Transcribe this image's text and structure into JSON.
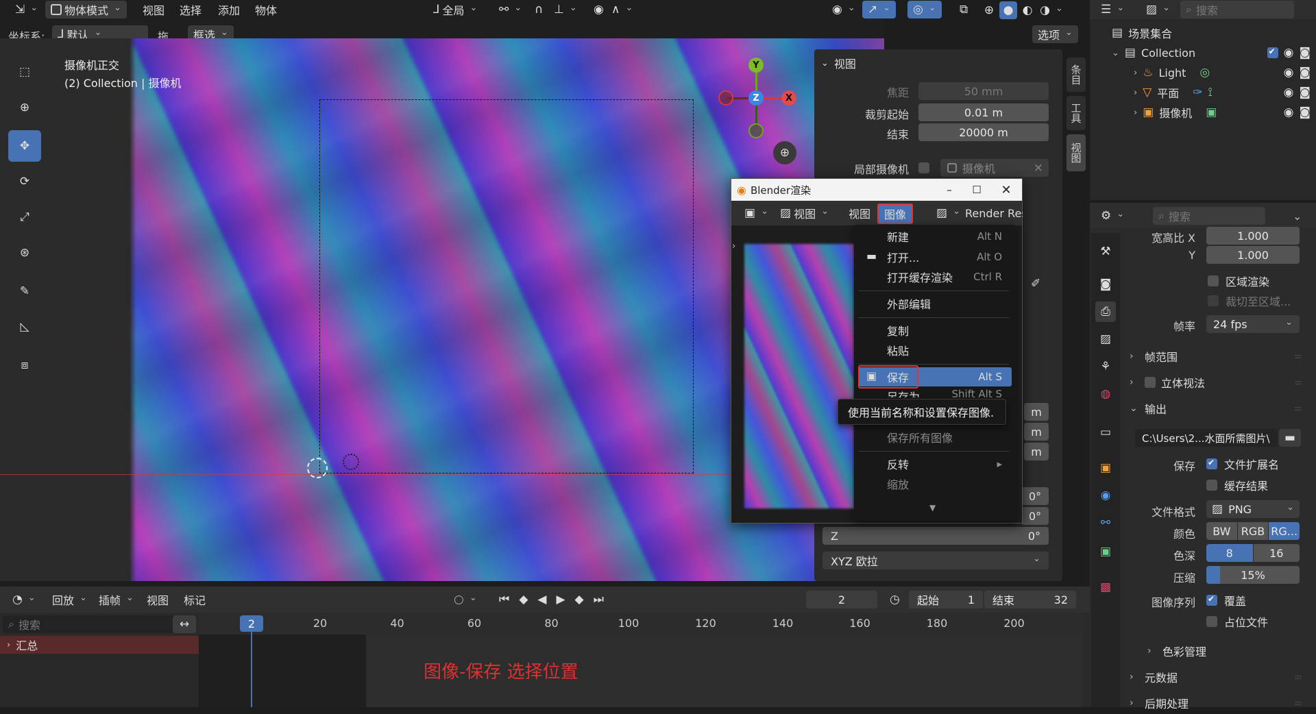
{
  "topbar": {
    "editor_icon": "axis-editor-icon",
    "mode": "物体模式",
    "menus": [
      "视图",
      "选择",
      "添加",
      "物体"
    ],
    "orientation": "全局",
    "options": "选项"
  },
  "toolheader": {
    "coord_label": "坐标系:",
    "coord_value": "默认",
    "drag_label": "拖...",
    "select_mode": "框选"
  },
  "viewport": {
    "overlay_line1": "摄像机正交",
    "overlay_line2": "(2) Collection | 摄像机",
    "gizmo": {
      "x": "X",
      "y": "Y",
      "z": "Z"
    }
  },
  "npanel": {
    "section": "视图",
    "focal_label": "焦距",
    "focal_value": "50 mm",
    "clip_start_label": "裁剪起始",
    "clip_start_value": "0.01 m",
    "clip_end_label": "结束",
    "clip_end_value": "20000 m",
    "local_camera_label": "局部摄像机",
    "local_camera_value": "摄像机",
    "tabs": [
      "条目",
      "工具",
      "视图"
    ],
    "partial_units": [
      "m",
      "m",
      "m"
    ],
    "rot_values": [
      "0°",
      "0°"
    ],
    "z_label": "Z",
    "z_value": "0°",
    "rot_mode": "XYZ 欧拉"
  },
  "render_window": {
    "title": "Blender渲染",
    "menu_view_dd": "视图",
    "menu_view": "视图",
    "menu_image": "图像",
    "render_result": "Render Res"
  },
  "image_menu": {
    "new": "新建",
    "new_sc": "Alt N",
    "open": "打开...",
    "open_sc": "Alt O",
    "open_cache": "打开缓存渲染",
    "open_cache_sc": "Ctrl R",
    "external_edit": "外部编辑",
    "copy": "复制",
    "paste": "粘贴",
    "save": "保存",
    "save_sc": "Alt S",
    "save_as_partial": "另存为",
    "save_as_sc_partial": "Shift Alt S",
    "save_all": "保存所有图像",
    "invert": "反转",
    "zoom": "缩放",
    "tooltip": "使用当前名称和设置保存图像."
  },
  "outliner": {
    "search_placeholder": "搜索",
    "scene_collection": "场景集合",
    "collection": "Collection",
    "items": [
      "Light",
      "平面",
      "摄像机"
    ]
  },
  "properties": {
    "search_placeholder": "搜索",
    "aspect_x_label": "宽高比 X",
    "aspect_x": "1.000",
    "aspect_y_label": "Y",
    "aspect_y": "1.000",
    "region_render": "区域渲染",
    "crop_region": "裁切至区域...",
    "fps_label": "帧率",
    "fps": "24 fps",
    "frame_range": "帧范围",
    "stereo": "立体视法",
    "output": "输出",
    "output_path": "C:\\Users\\2...水面所需图片\\",
    "save_label": "保存",
    "file_ext": "文件扩展名",
    "cache_result": "缓存结果",
    "format_label": "文件格式",
    "format": "PNG",
    "color_label": "颜色",
    "color_opts": [
      "BW",
      "RGB",
      "RG..."
    ],
    "depth_label": "色深",
    "depth_opts": [
      "8",
      "16"
    ],
    "compress_label": "压缩",
    "compress": "15%",
    "compress_fraction": 0.15,
    "seq_label": "图像序列",
    "overwrite": "覆盖",
    "placeholder": "占位文件",
    "color_mgmt": "色彩管理",
    "metadata": "元数据",
    "post": "后期处理"
  },
  "timeline": {
    "playback": "回放",
    "keying": "插帧",
    "view": "视图",
    "marker": "标记",
    "current": "2",
    "start_label": "起始",
    "start": "1",
    "end_label": "结束",
    "end": "32",
    "search_placeholder": "搜索",
    "summary": "汇总",
    "ticks": [
      "20",
      "40",
      "60",
      "80",
      "100",
      "120",
      "140",
      "160",
      "180",
      "200"
    ],
    "cur_badge": "2"
  },
  "annotation": "图像-保存 选择位置",
  "colors": {
    "accent": "#4772b3",
    "highlight_red": "#e03535",
    "annotation_red": "#e03030"
  }
}
